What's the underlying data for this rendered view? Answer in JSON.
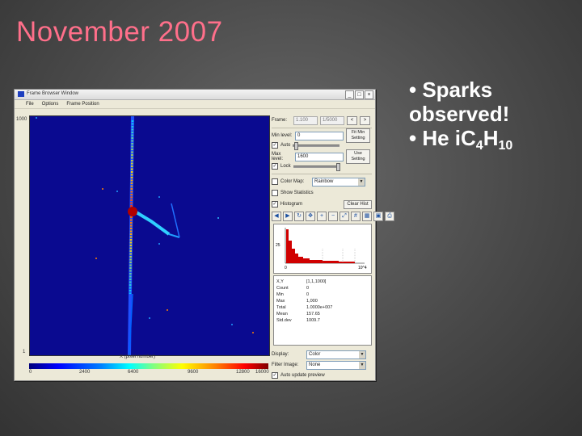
{
  "slide": {
    "title": "November 2007",
    "bullet_1": "• Sparks observed!",
    "bullet_2_prefix": "• He iC",
    "bullet_2_sub1": "4",
    "bullet_2_mid": "H",
    "bullet_2_sub2": "10"
  },
  "window": {
    "title": "Frame Browser Window",
    "menu": [
      "File",
      "Options",
      "Frame Position"
    ],
    "colorbar_ticks": [
      "0",
      "2400",
      "6400",
      "9600",
      "12800",
      "16000"
    ],
    "x_axis_label": "X (pixel number)",
    "y_axis_top": "1000",
    "y_axis_bottom": "1"
  },
  "panel": {
    "frame_label": "Frame:",
    "frame_value": "1.100",
    "frame_total": "1/5000",
    "prev_btn": "<",
    "next_btn": ">",
    "min_label": "Min level:",
    "min_value": "0",
    "fit_min_btn": "Fit Min Setting",
    "max_label": "Max level:",
    "max_value": "1600",
    "fit_max_btn": "Use Setting",
    "auto_label": "Auto",
    "lock_label": "Lock",
    "colormap_label": "Color Map:",
    "colormap_value": "Rainbow",
    "stats_label": "Show Statistics",
    "histogram_label": "Histogram",
    "clear_btn": "Clear Hist",
    "hist_y_tick": "25",
    "hist_x_start": "0",
    "hist_x_end": "10^4",
    "stats_rows": [
      {
        "k": "X,Y",
        "v": "[1,1,1000]"
      },
      {
        "k": "Count",
        "v": "0"
      },
      {
        "k": "Min",
        "v": "0"
      },
      {
        "k": "Max",
        "v": "1,000"
      },
      {
        "k": "Total",
        "v": "1.0000e+007"
      },
      {
        "k": "Mean",
        "v": "157.65"
      },
      {
        "k": "Std.dev",
        "v": "1009.7"
      }
    ],
    "display_label": "Display:",
    "display_value": "Color",
    "filter_label": "Filter Image:",
    "filter_value": "None",
    "auto_update_label": "Auto update preview"
  },
  "colors": {
    "title": "#ff6f8a",
    "plot_bg": "#0a0a90",
    "slide_text": "#ffffff"
  }
}
